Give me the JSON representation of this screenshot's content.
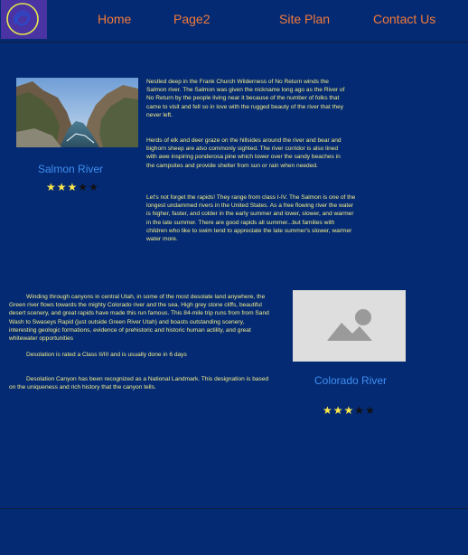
{
  "nav": {
    "items": [
      {
        "label": "Home"
      },
      {
        "label": "Page2"
      },
      {
        "label": "Site Plan"
      },
      {
        "label": "Contact Us"
      }
    ]
  },
  "colors": {
    "background": "#042a73",
    "nav_link": "#f27a3a",
    "body_text": "#f2ee8c",
    "river_title": "#3f8ff2",
    "star_on": "#ffe94a",
    "star_off": "#101010"
  },
  "salmon": {
    "title": "Salmon River",
    "rating": 3,
    "rating_max": 5,
    "paragraphs": [
      "Nestled deep in the Frank Church Wilderness of No Return winds the Salmon river. The Salmon was given the nickname long ago as the River of No Return by the people living near it because of the number of folks that came to visit and fell so in love with the rugged beauty of the river that they never left.",
      "Herds of elk and deer graze on the hillsides around the river and bear and bighorn sheep are also commonly sighted. The river corridor is also lined with awe inspiring ponderosa pine which tower over the sandy beaches in the campsites and provide shelter from sun or rain when needed.",
      "Let's not forget the rapids! They range from class I-IV. The Salmon is one of the longest undammed rivers in the United States. As a free flowing river the water is higher, faster, and colder in the early summer and lower, slower, and warmer in the late summer. There are good rapids all summer...but families with children who like to swim tend to appreciate the late summer's slower, warmer water more."
    ]
  },
  "colorado": {
    "title": "Colorado River",
    "rating": 3,
    "rating_max": 5,
    "paragraphs": [
      "Winding through canyons in central Utah, in some of the most desolate land anywhere, the Green river flows towards the mighty Colorado river and the sea. High grey stone cliffs, beautiful desert scenery, and great rapids have made this run famous. This 84-mile trip runs from from Sand Wash to Swaseys Rapid (just outside Green River Utah) and boasts outstanding scenery, interesting geologic formations, evidence of prehistoric and historic human actility, and great whitewater opportunities",
      "Desolation is rated a Class II/III and is usually done in 6 days",
      "Desolation Canyon has been recognized as a National Landmark. This designation is based on the uniqueness and rich history that the canyon tells."
    ]
  }
}
